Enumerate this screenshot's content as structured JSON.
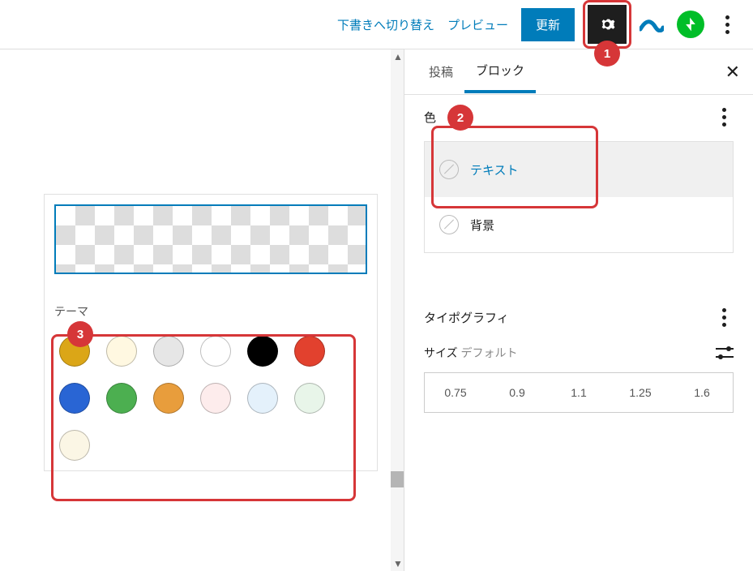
{
  "topbar": {
    "draft": "下書きへ切り替え",
    "preview": "プレビュー",
    "update": "更新"
  },
  "annotations": {
    "a1": "1",
    "a2": "2",
    "a3": "3"
  },
  "popover": {
    "theme_label": "テーマ",
    "swatches": [
      [
        "#dba617",
        "#fff8e1",
        "#e6e6e6",
        "#ffffff",
        "#000000",
        "#e2412e"
      ],
      [
        "#2965d4",
        "#4caf50",
        "#e89d3c",
        "#fdecec",
        "#e4f1fb",
        "#e8f5e9"
      ],
      [
        "#fbf6e5"
      ]
    ]
  },
  "sidebar": {
    "tab_post": "投稿",
    "tab_block": "ブロック",
    "color": {
      "title": "色",
      "text": "テキスト",
      "bg": "背景"
    },
    "typo": {
      "title": "タイポグラフィ",
      "size": "サイズ",
      "default": "デフォルト",
      "presets": [
        "0.75",
        "0.9",
        "1.1",
        "1.25",
        "1.6"
      ]
    }
  }
}
